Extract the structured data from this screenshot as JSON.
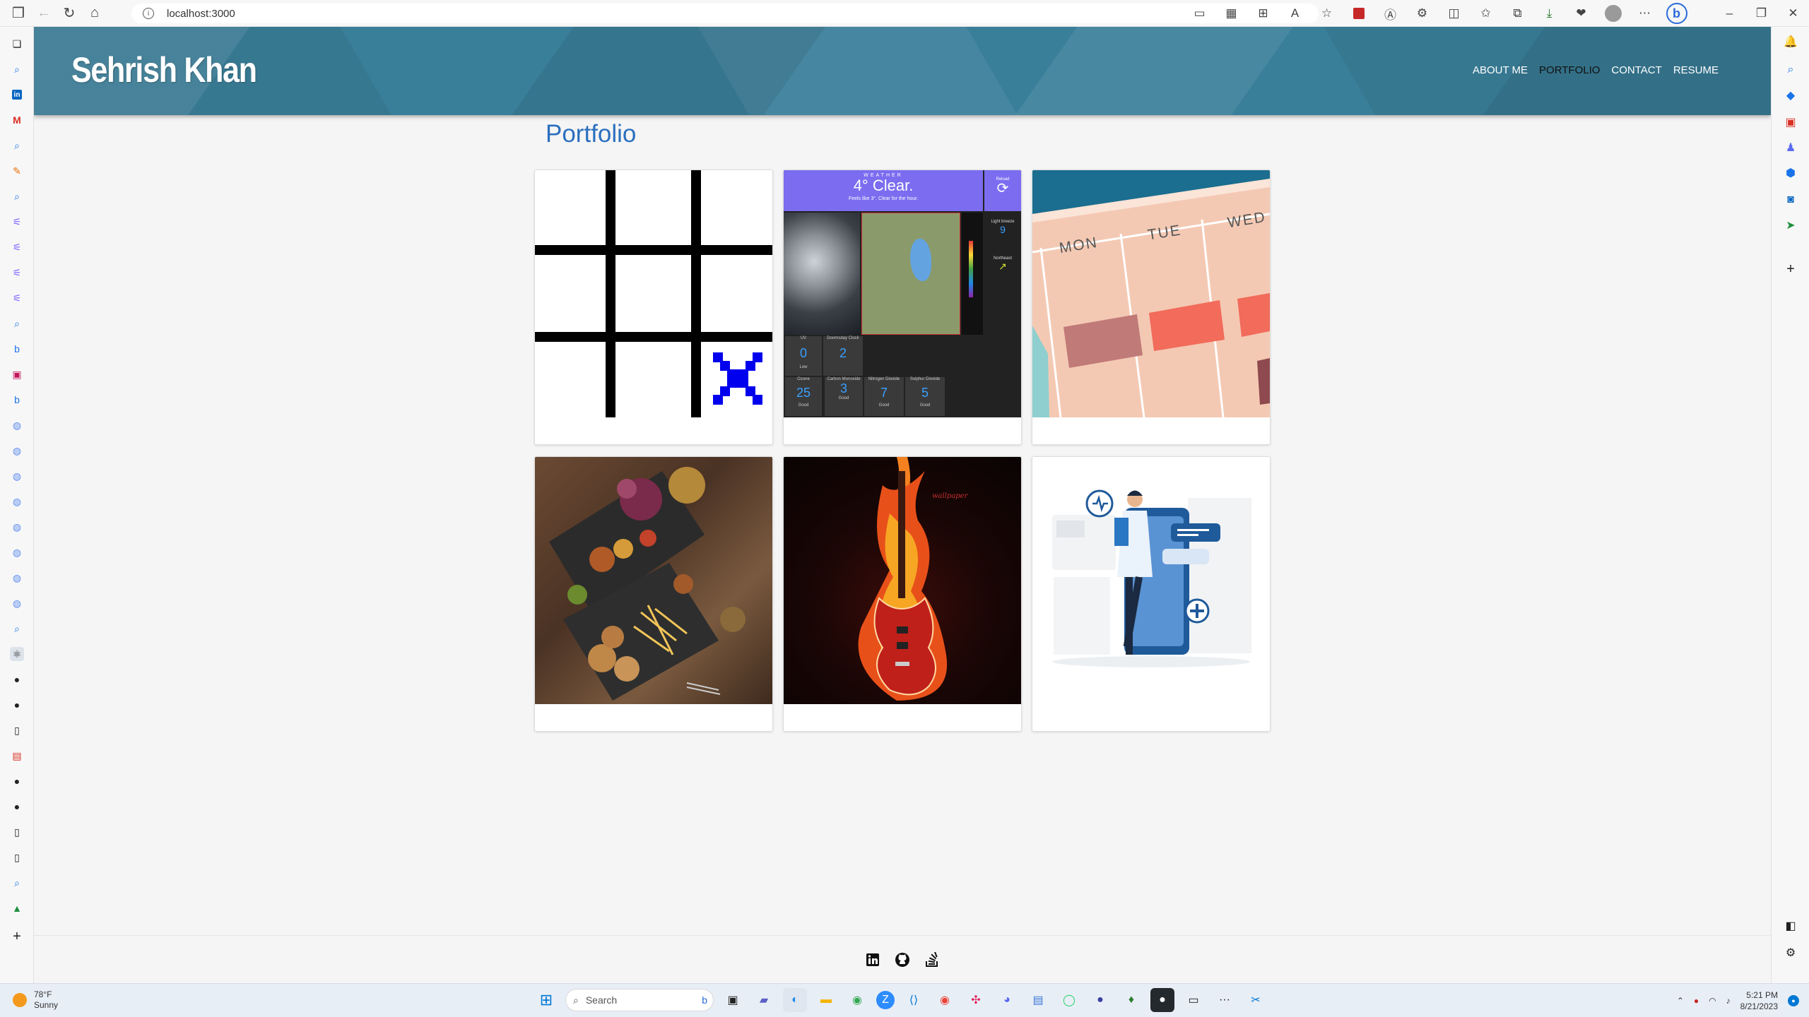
{
  "browser": {
    "url": "localhost:3000"
  },
  "site": {
    "name": "Sehrish Khan",
    "nav": [
      "ABOUT ME",
      "PORTFOLIO",
      "CONTACT",
      "RESUME"
    ],
    "active_nav": "PORTFOLIO"
  },
  "portfolio": {
    "title": "Portfolio",
    "projects": [
      {
        "thumb": "tic-tac-toe"
      },
      {
        "thumb": "weather-app"
      },
      {
        "thumb": "calendar-planner"
      },
      {
        "thumb": "food-table"
      },
      {
        "thumb": "flaming-guitar"
      },
      {
        "thumb": "doctor-app"
      }
    ],
    "weather_thumb": {
      "heading": "WEATHER",
      "temp": "4° Clear.",
      "feels": "Feels like 3°. Clear for the hour.",
      "reload": "Reload",
      "light_breeze": "Light breeze",
      "wind_val": "9",
      "direction": "Northeast",
      "tiles": [
        {
          "label": "UV",
          "value": "0",
          "status": "Low"
        },
        {
          "label": "Doomsday Clock",
          "value": "2",
          "status": ""
        },
        {
          "label": "Ozone",
          "value": "25",
          "status": "Good"
        },
        {
          "label": "Carbon Monoxide",
          "value": "3",
          "status": "Good"
        },
        {
          "label": "Nitrogen Dioxide",
          "value": "7",
          "status": "Good"
        },
        {
          "label": "Sulphur Dioxide",
          "value": "5",
          "status": "Good"
        }
      ]
    },
    "calendar_thumb": {
      "days": [
        "MON",
        "TUE",
        "WED"
      ]
    }
  },
  "taskbar": {
    "weather_temp": "78°F",
    "weather_desc": "Sunny",
    "search_placeholder": "Search",
    "time": "5:21 PM",
    "date": "8/21/2023"
  },
  "colors": {
    "header": "#3a7f9a",
    "title": "#2a6fbe",
    "weather_header": "#7b6cf0"
  }
}
